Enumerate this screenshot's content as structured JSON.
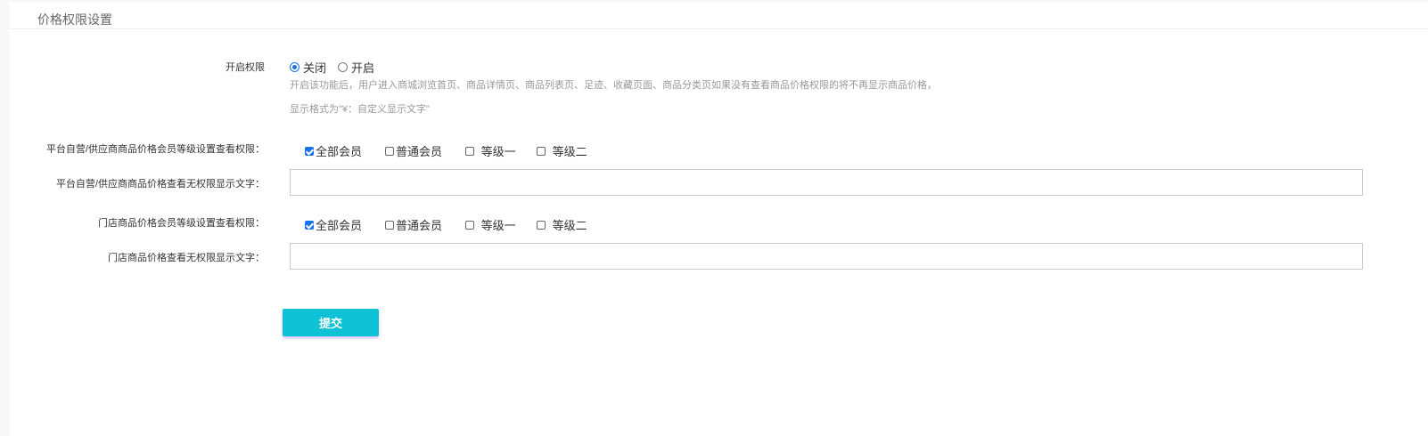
{
  "title": "价格权限设置",
  "enable": {
    "label": "开启权限",
    "options": [
      "关闭",
      "开启"
    ],
    "selected": "关闭",
    "hint1": "开启该功能后，用户进入商城浏览首页、商品详情页、商品列表页、足迹、收藏页面、商品分类页如果没有查看商品价格权限的将不再显示商品价格，",
    "hint2": "显示格式为\"¥：自定义显示文字\""
  },
  "platform_levels": {
    "label": "平台自营/供应商商品价格会员等级设置查看权限：",
    "options": [
      {
        "label": "全部会员",
        "checked": true
      },
      {
        "label": "普通会员",
        "checked": false
      },
      {
        "label": "等级一",
        "checked": false
      },
      {
        "label": "等级二",
        "checked": false
      }
    ]
  },
  "platform_text": {
    "label": "平台自营/供应商商品价格查看无权限显示文字：",
    "value": ""
  },
  "store_levels": {
    "label": "门店商品价格会员等级设置查看权限：",
    "options": [
      {
        "label": "全部会员",
        "checked": true
      },
      {
        "label": "普通会员",
        "checked": false
      },
      {
        "label": "等级一",
        "checked": false
      },
      {
        "label": "等级二",
        "checked": false
      }
    ]
  },
  "store_text": {
    "label": "门店商品价格查看无权限显示文字：",
    "value": ""
  },
  "submit": "提交"
}
